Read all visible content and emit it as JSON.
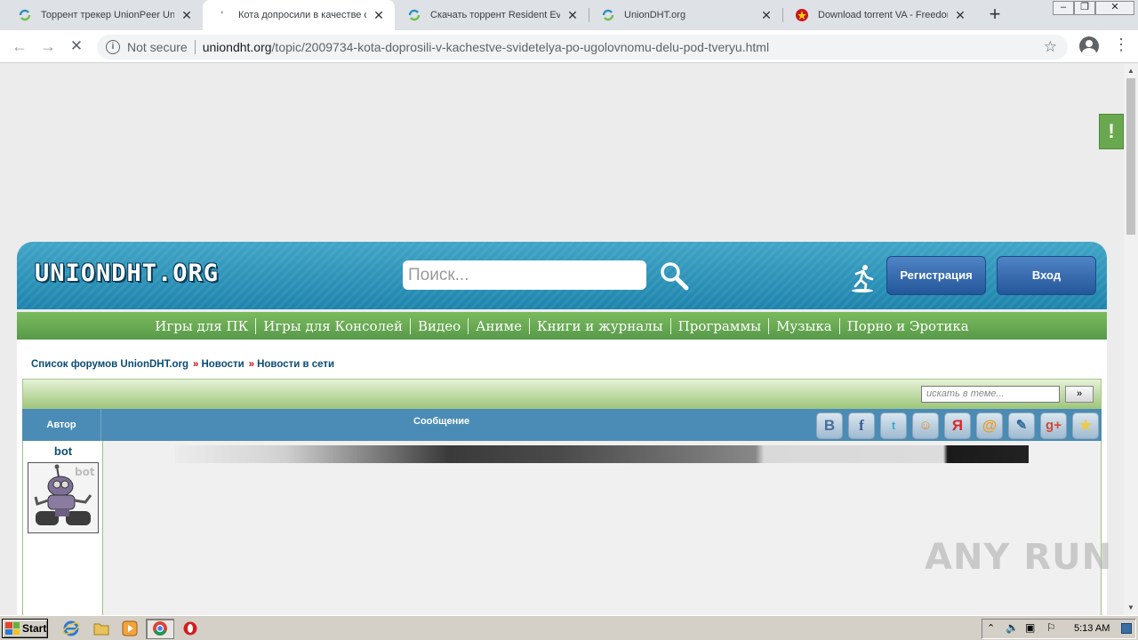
{
  "browser": {
    "tabs": [
      {
        "title": "Торрент трекер UnionPeer Uni",
        "active": false
      },
      {
        "title": "Кота допросили в качестве св",
        "active": true
      },
      {
        "title": "Скачать торрент Resident Evil",
        "active": false
      },
      {
        "title": "UnionDHT.org",
        "active": false
      },
      {
        "title": "Download torrent VA - Freedom",
        "active": false
      }
    ],
    "security_label": "Not secure",
    "url_host": "uniondht.org",
    "url_path": "/topic/2009734-kota-doprosili-v-kachestve-svidetelya-po-ugolovnomu-delu-pod-tveryu.html"
  },
  "site": {
    "logo": "UNIONDHT.ORG",
    "search_placeholder": "Поиск...",
    "register_label": "Регистрация",
    "login_label": "Вход",
    "nav": [
      "Игры для ПК",
      "Игры для Консолей",
      "Видео",
      "Аниме",
      "Книги и журналы",
      "Программы",
      "Музыка",
      "Порно и Эротика"
    ],
    "breadcrumb": [
      "Список форумов UnionDHT.org",
      "Новости",
      "Новости в сети"
    ],
    "topic_search_placeholder": "искать в теме...",
    "topic_search_go": "»",
    "col_author": "Автор",
    "col_message": "Сообщение",
    "post_author": "bot",
    "feedback_label": "!",
    "social_icons": [
      "vk-icon",
      "facebook-icon",
      "twitter-icon",
      "odnoklassniki-icon",
      "yandex-icon",
      "mail-icon",
      "livejournal-icon",
      "google-plus-icon",
      "favorites-star-icon"
    ]
  },
  "watermark": "ANY RUN",
  "taskbar": {
    "start_label": "Start",
    "clock": "5:13 AM"
  }
}
